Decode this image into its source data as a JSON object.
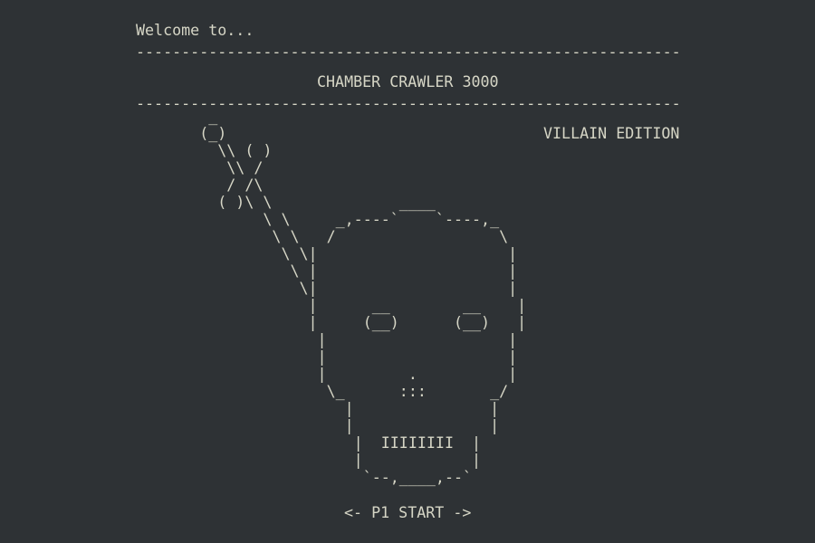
{
  "screen": {
    "welcome": "Welcome to...",
    "rule": "------------------------------------------------------------",
    "title": "CHAMBER CRAWLER 3000",
    "edition": "VILLAIN EDITION",
    "art": [
      "        _",
      "       (_)",
      "         \\\\ ( )",
      "          \\\\ /",
      "          / /\\",
      "         ( )\\ \\              ____",
      "              \\ \\     _,----`    `----,_",
      "               \\ \\   /                  \\",
      "                \\ \\|                     |",
      "                 \\ |                     |",
      "                  \\|                     |",
      "                   |      __        __    |",
      "                   |     (__)      (__)   |",
      "                    |                    |",
      "                    |                    |",
      "                    |         .          |",
      "                     \\_      :::       _/",
      "                       |               |",
      "                       |               |",
      "                        |  IIIIIIII  |",
      "                        |            |",
      "                         `--,____,--`"
    ],
    "start_prompt": "<- P1 START ->",
    "colors": {
      "background": "#2e3235",
      "text": "#d6d6c6"
    }
  }
}
